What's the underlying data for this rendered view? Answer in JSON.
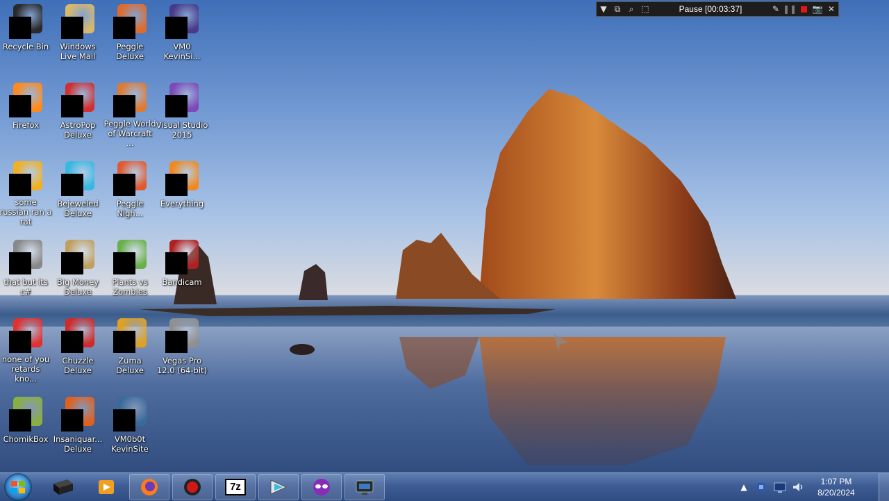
{
  "recorder": {
    "title": "Pause [00:03:37]"
  },
  "desktop_icons": [
    {
      "label": "Recycle Bin",
      "color": "#2a2a2a"
    },
    {
      "label": "Windows Live Mail",
      "color": "#d8b86a"
    },
    {
      "label": "Peggle Deluxe",
      "color": "#e06a2a"
    },
    {
      "label": "VM0 KevinSi...",
      "color": "#4a3a8a"
    },
    {
      "label": "Firefox",
      "color": "#ff8a1a"
    },
    {
      "label": "AstroPop Deluxe",
      "color": "#d03030"
    },
    {
      "label": "Peggle World of Warcraft ...",
      "color": "#e07a30"
    },
    {
      "label": "Visual Studio 2015",
      "color": "#7d4ab8"
    },
    {
      "label": "some russian ran a rat",
      "color": "#f0b020"
    },
    {
      "label": "Bejeweled Deluxe",
      "color": "#3ab8e0"
    },
    {
      "label": "Peggle Nigh...",
      "color": "#e05a30"
    },
    {
      "label": "Everything",
      "color": "#f08a20"
    },
    {
      "label": "that but its c#",
      "color": "#888888"
    },
    {
      "label": "Big Money Deluxe",
      "color": "#c0a060"
    },
    {
      "label": "Plants vs Zombies",
      "color": "#6ab04a"
    },
    {
      "label": "Bandicam",
      "color": "#b02020"
    },
    {
      "label": "none of you retards kno...",
      "color": "#e03030"
    },
    {
      "label": "Chuzzle Deluxe",
      "color": "#d02a2a"
    },
    {
      "label": "Zuma Deluxe",
      "color": "#e0a020"
    },
    {
      "label": "Vegas Pro 12.0 (64-bit)",
      "color": "#909090"
    },
    {
      "label": "ChomikBox",
      "color": "#8ab040"
    },
    {
      "label": "Insaniquar... Deluxe",
      "color": "#e06020"
    },
    {
      "label": "VM0b0t KevinSite",
      "color": "#3a6a9a"
    }
  ],
  "taskbar": {
    "items": [
      {
        "name": "vm-window",
        "icon": "black-box-icon"
      },
      {
        "name": "media-player",
        "icon": "media-player-icon"
      },
      {
        "name": "firefox",
        "icon": "firefox-icon"
      },
      {
        "name": "bandicam",
        "icon": "bandicam-icon"
      },
      {
        "name": "7zip",
        "icon": "7zip-icon",
        "text": "7z"
      },
      {
        "name": "vegas-pro",
        "icon": "vegas-pro-icon"
      },
      {
        "name": "mask-app",
        "icon": "mask-icon"
      },
      {
        "name": "virtual-machine",
        "icon": "vm-icon"
      }
    ]
  },
  "tray": {
    "time": "1:07 PM",
    "date": "8/20/2024"
  }
}
